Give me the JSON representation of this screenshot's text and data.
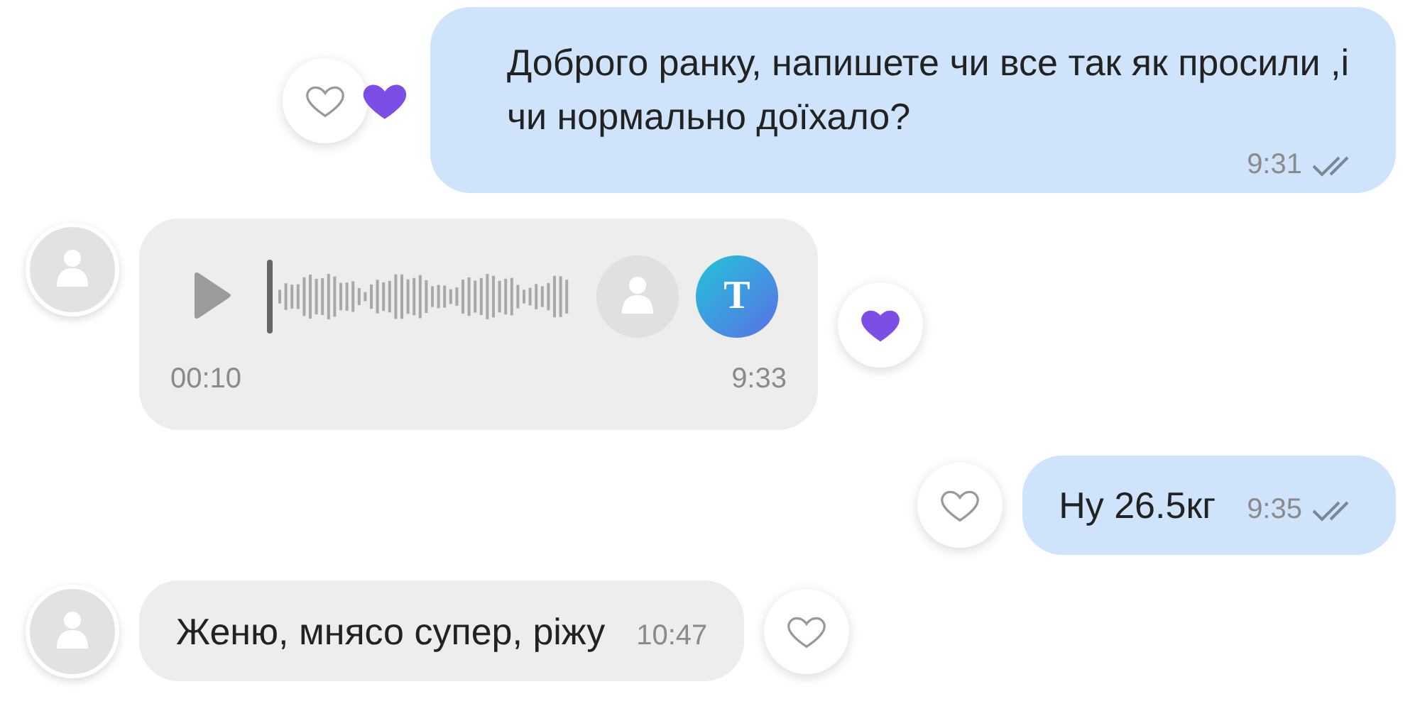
{
  "messages": [
    {
      "kind": "text",
      "outgoing": true,
      "text": "Доброго ранку, напишете чи все так як просили ,і чи нормально доїхало?",
      "time": "9:31",
      "read": true,
      "liked": false,
      "other_liked": true
    },
    {
      "kind": "voice",
      "outgoing": false,
      "duration": "00:10",
      "time": "9:33",
      "transcribe": "T",
      "liked": true,
      "other_liked": false
    },
    {
      "kind": "text",
      "outgoing": true,
      "text": "Ну 26.5кг",
      "time": "9:35",
      "read": true,
      "liked": false,
      "other_liked": false
    },
    {
      "kind": "text",
      "outgoing": false,
      "text": "Женю, мнясо супер, ріжу",
      "time": "10:47",
      "liked": false,
      "other_liked": false
    }
  ]
}
